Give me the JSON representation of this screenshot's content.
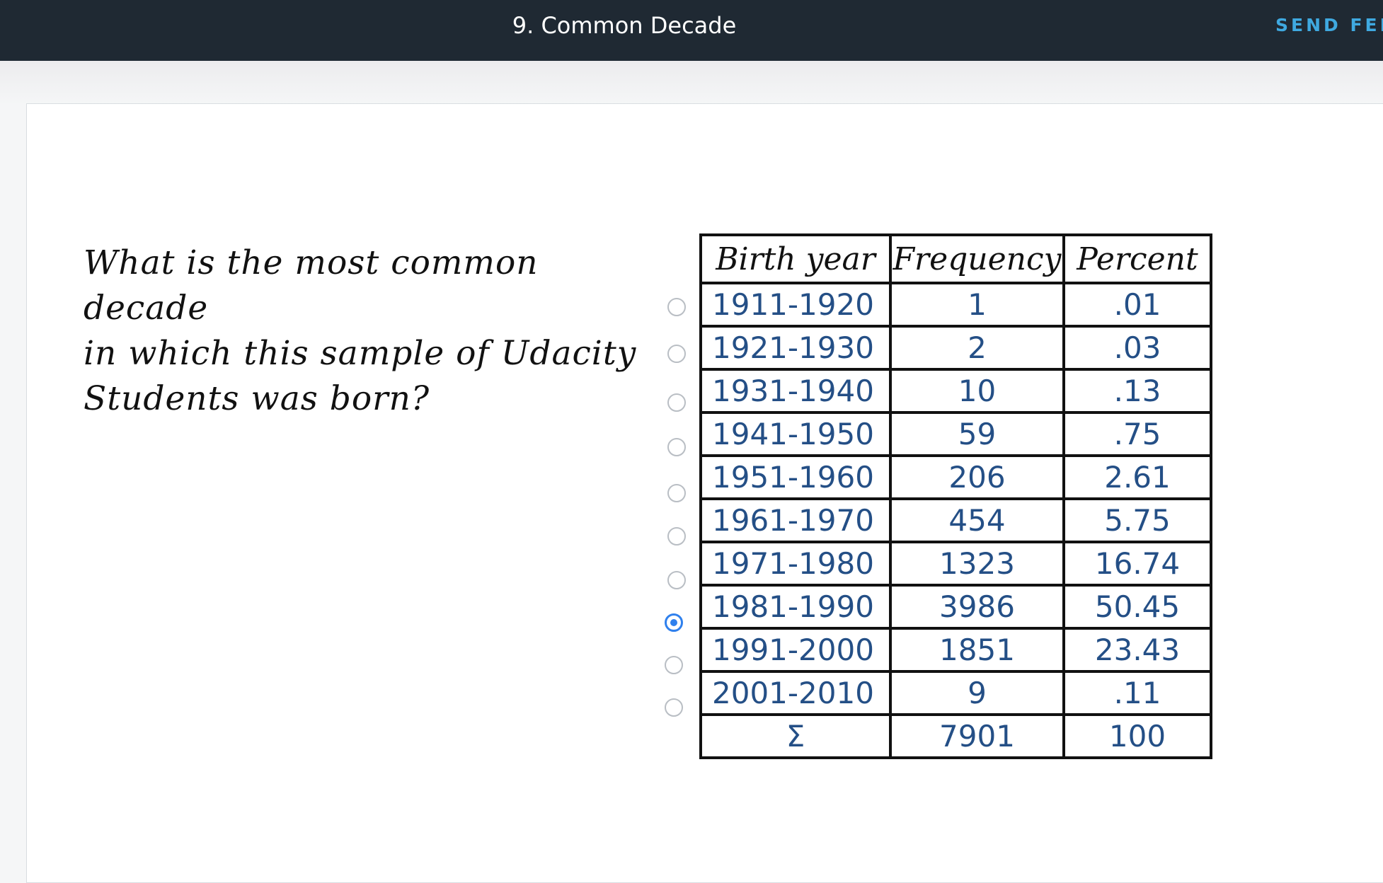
{
  "header": {
    "title": "9. Common Decade",
    "feedback_label": "SEND FEED"
  },
  "question": {
    "text": "What is the most common decade\nin which this sample of Udacity\nStudents was born?"
  },
  "table": {
    "headers": [
      "Birth year",
      "Frequency",
      "Percent"
    ],
    "rows": [
      [
        "1911-1920",
        "1",
        ".01"
      ],
      [
        "1921-1930",
        "2",
        ".03"
      ],
      [
        "1931-1940",
        "10",
        ".13"
      ],
      [
        "1941-1950",
        "59",
        ".75"
      ],
      [
        "1951-1960",
        "206",
        "2.61"
      ],
      [
        "1961-1970",
        "454",
        "5.75"
      ],
      [
        "1971-1980",
        "1323",
        "16.74"
      ],
      [
        "1981-1990",
        "3986",
        "50.45"
      ],
      [
        "1991-2000",
        "1851",
        "23.43"
      ],
      [
        "2001-2010",
        "9",
        ".11"
      ]
    ],
    "total": [
      "Σ",
      "7901",
      "100"
    ]
  },
  "answer": {
    "options_count": 10,
    "selected_index": 7
  },
  "colors": {
    "header_bg": "#1f2933",
    "feedback": "#3fa9e0",
    "radio_selected": "#2f80ed",
    "handwriting_blue": "#244f86"
  }
}
